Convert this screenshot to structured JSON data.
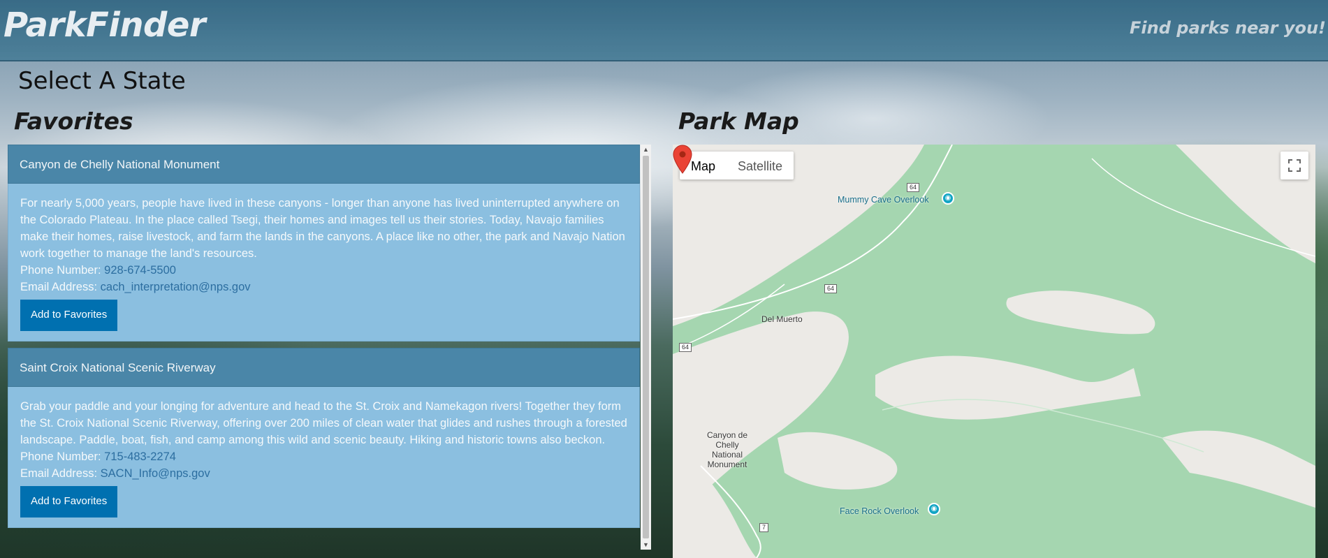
{
  "header": {
    "brand": "ParkFinder",
    "tagline": "Find parks near you!"
  },
  "state_selector": {
    "label": "Select A State"
  },
  "favorites": {
    "title": "Favorites",
    "cards": [
      {
        "name": "Canyon de Chelly National Monument",
        "description": "For nearly 5,000 years, people have lived in these canyons - longer than anyone has lived uninterrupted anywhere on the Colorado Plateau. In the place called Tsegi, their homes and images tell us their stories. Today, Navajo families make their homes, raise livestock, and farm the lands in the canyons. A place like no other, the park and Navajo Nation work together to manage the land's resources.",
        "phone_label": "Phone Number:",
        "phone": "928-674-5500",
        "email_label": "Email Address:",
        "email": "cach_interpretation@nps.gov",
        "button": "Add to Favorites"
      },
      {
        "name": "Saint Croix National Scenic Riverway",
        "description": "Grab your paddle and your longing for adventure and head to the St. Croix and Namekagon rivers! Together they form the St. Croix National Scenic Riverway, offering over 200 miles of clean water that glides and rushes through a forested landscape. Paddle, boat, fish, and camp among this wild and scenic beauty. Hiking and historic towns also beckon.",
        "phone_label": "Phone Number:",
        "phone": "715-483-2274",
        "email_label": "Email Address:",
        "email": "SACN_Info@nps.gov",
        "button": "Add to Favorites"
      }
    ]
  },
  "map": {
    "title": "Park Map",
    "type_options": [
      "Map",
      "Satellite"
    ],
    "selected_type": "Map",
    "places": {
      "mummy_cave": "Mummy Cave Overlook",
      "del_muerto": "Del Muerto",
      "canyon_de_chelly": "Canyon de Chelly National Monument",
      "face_rock": "Face Rock Overlook"
    },
    "road_shields": [
      "64",
      "64",
      "64",
      "7"
    ],
    "colors": {
      "park": "#a5d6b0",
      "land": "#eceae6",
      "marker": "#ea4335",
      "poi": "#12a5c4"
    }
  }
}
